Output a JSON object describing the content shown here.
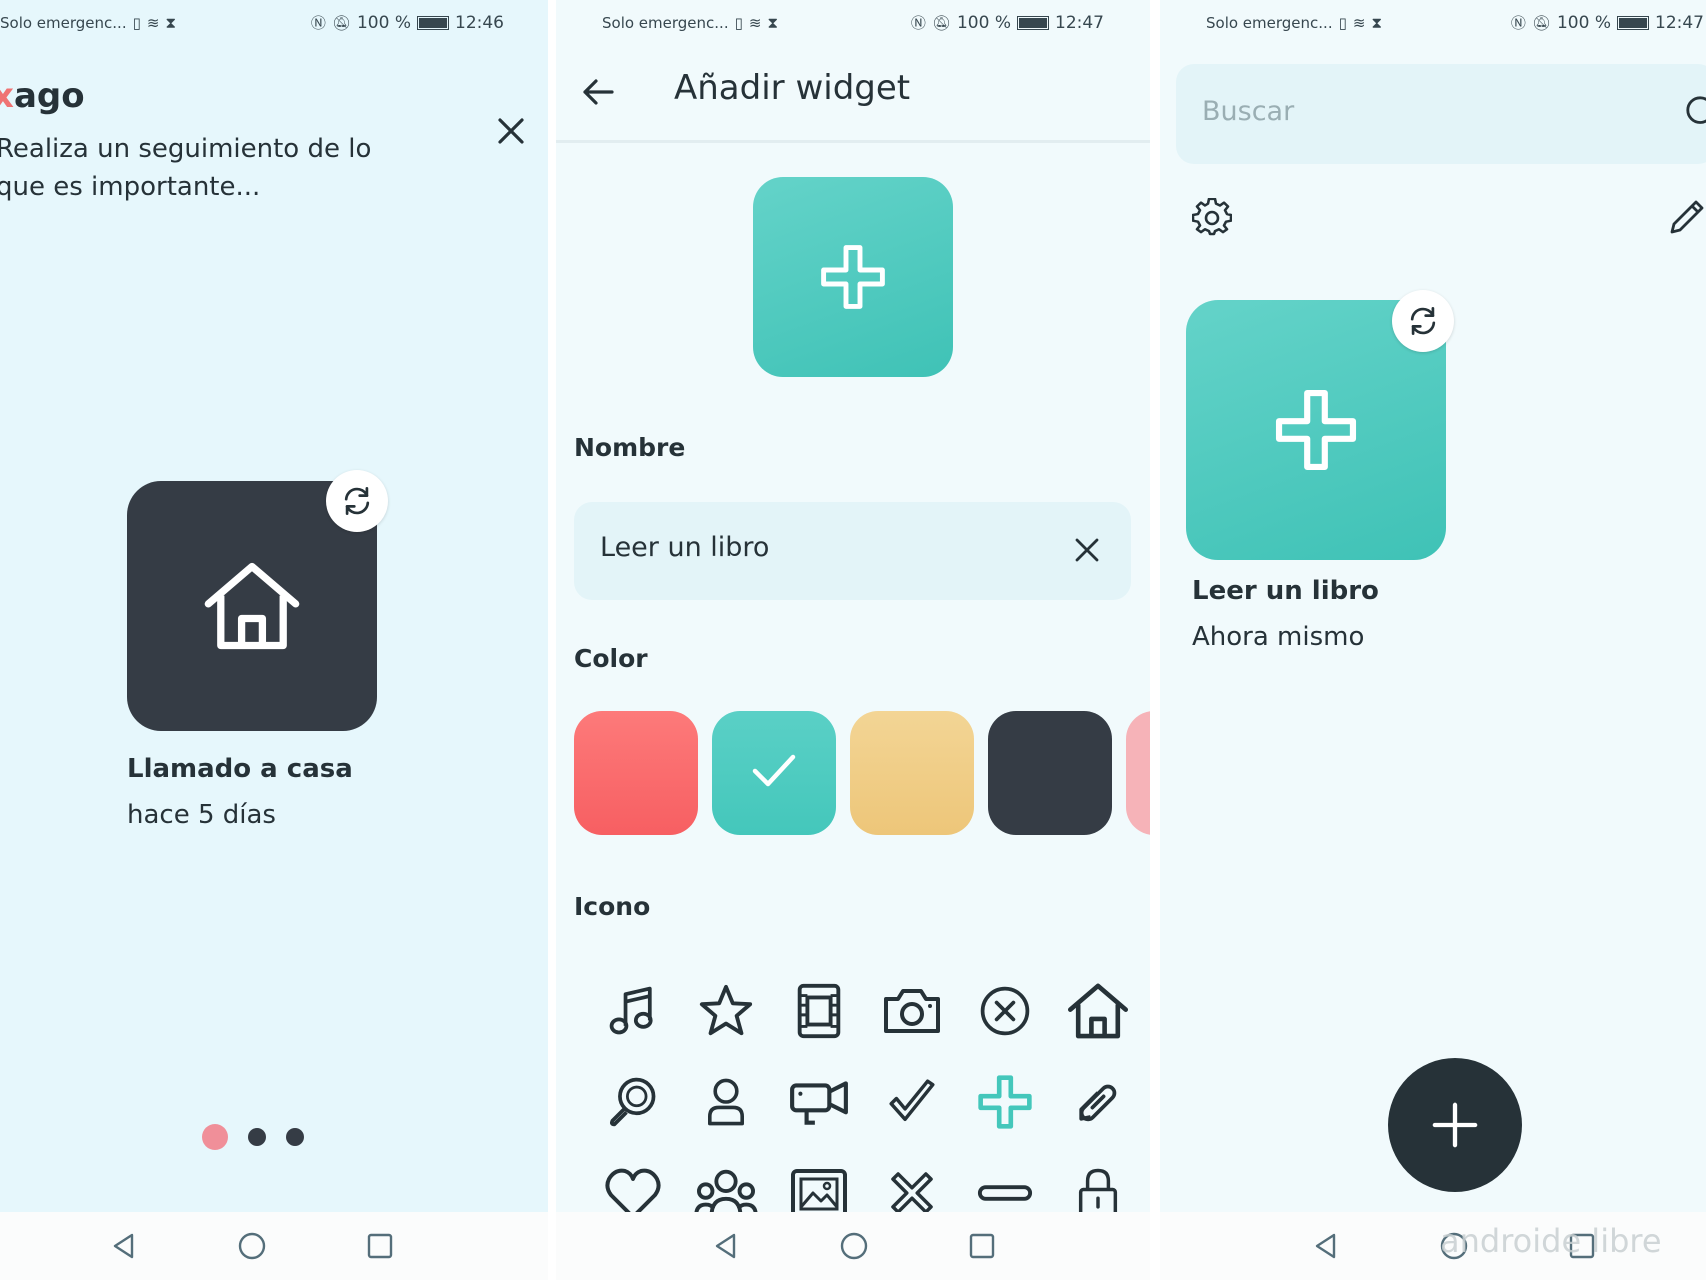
{
  "status_bar": {
    "left_text": "Solo emergenc...",
    "battery": "100 %"
  },
  "panels": [
    {
      "time": "12:46",
      "app_title_accent": "x",
      "app_title": "ago",
      "subtitle": "Realiza un seguimiento de lo que es importante...",
      "widget": {
        "name": "Llamado a casa",
        "when": "hace 5 días",
        "color": "#353c45",
        "icon": "house-icon"
      },
      "pagination": {
        "count": 3,
        "active": 1
      }
    },
    {
      "time": "12:47",
      "title": "Añadir widget",
      "name_label": "Nombre",
      "name_value": "Leer un libro",
      "color_label": "Color",
      "colors": [
        "#fb6b6b",
        "#48c9be",
        "#f0cd86",
        "#353c45",
        "#f6b3b8"
      ],
      "selected_color": 1,
      "icon_label": "Icono",
      "icons": [
        "music-icon",
        "star-icon",
        "film-icon",
        "camera-icon",
        "cancel-circle-icon",
        "house-icon",
        "magnifier-icon",
        "person-icon",
        "video-camera-icon",
        "check-icon",
        "plus-icon",
        "link-icon",
        "heart-icon",
        "group-icon",
        "image-icon",
        "x-icon",
        "minus-icon",
        "lock-icon"
      ],
      "selected_icon": 10
    },
    {
      "time": "12:47",
      "search_placeholder": "Buscar",
      "widget": {
        "name": "Leer un libro",
        "when": "Ahora mismo",
        "color": "#48c9be",
        "icon": "plus-icon"
      },
      "watermark": "androide libre"
    }
  ]
}
